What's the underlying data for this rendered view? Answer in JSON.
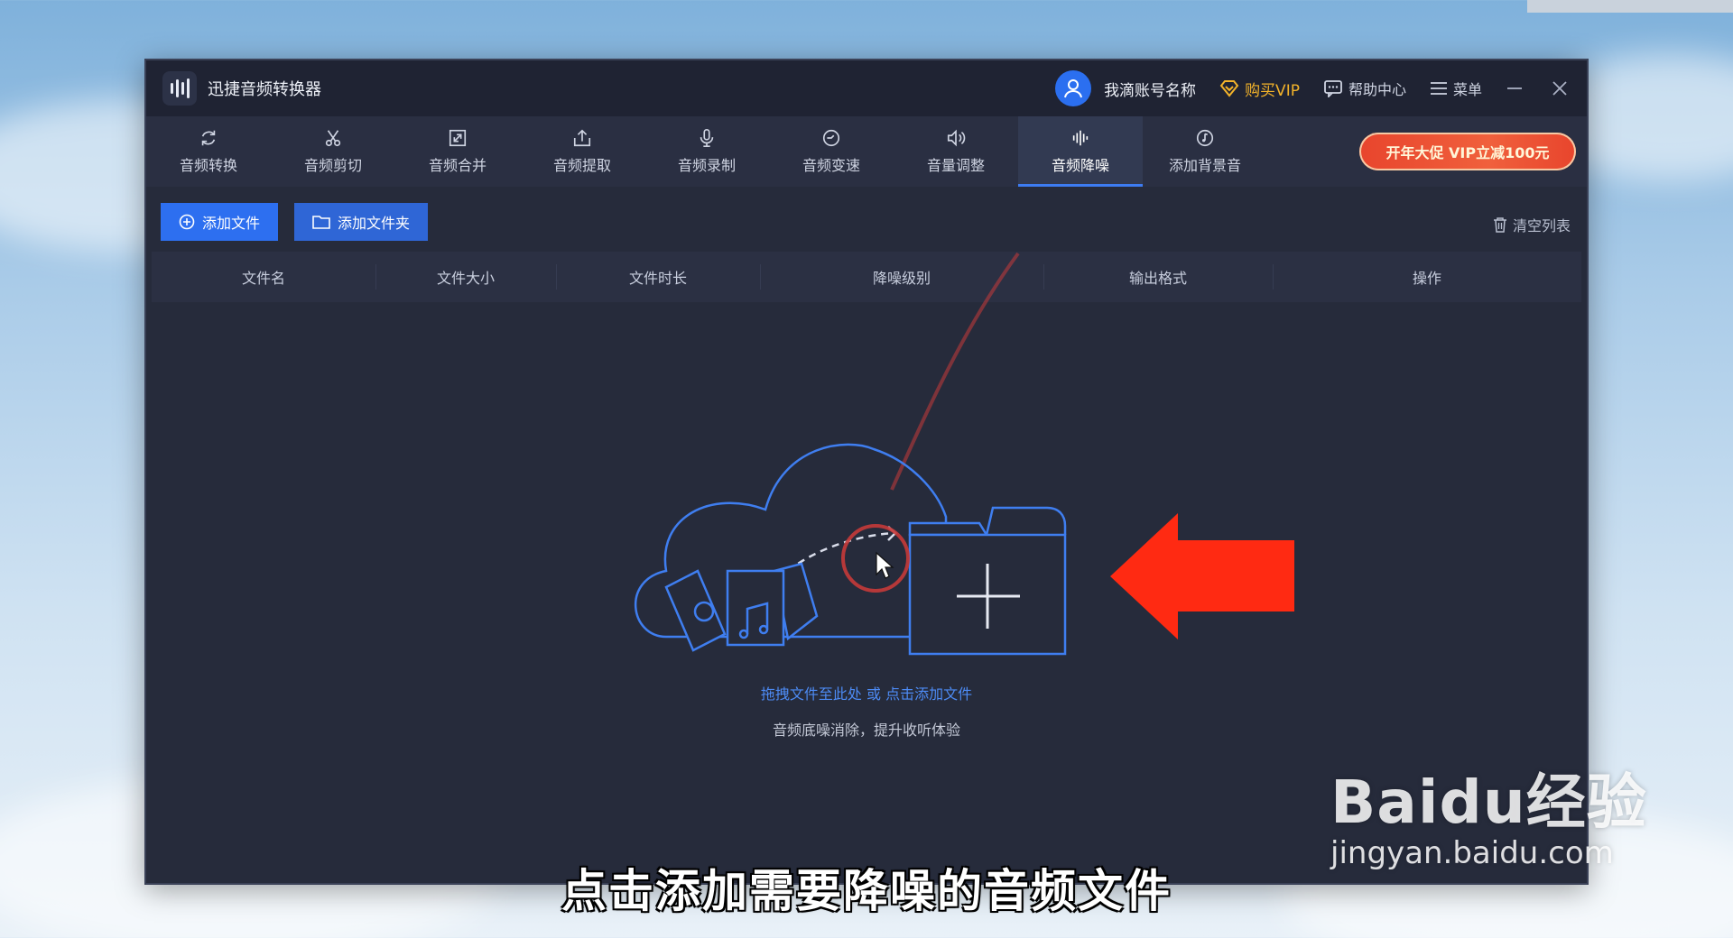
{
  "app": {
    "title": "迅捷音频转换器",
    "account_name": "我滴账号名称",
    "buy_vip": "购买VIP",
    "help_center": "帮助中心",
    "menu": "菜单"
  },
  "toolbar": {
    "tools": [
      {
        "label": "音频转换",
        "icon": "refresh-icon"
      },
      {
        "label": "音频剪切",
        "icon": "scissors-icon"
      },
      {
        "label": "音频合并",
        "icon": "merge-icon"
      },
      {
        "label": "音频提取",
        "icon": "extract-icon"
      },
      {
        "label": "音频录制",
        "icon": "microphone-icon"
      },
      {
        "label": "音频变速",
        "icon": "speed-icon"
      },
      {
        "label": "音量调整",
        "icon": "volume-icon"
      },
      {
        "label": "音频降噪",
        "icon": "waveform-icon",
        "active": true
      },
      {
        "label": "添加背景音",
        "icon": "music-note-icon"
      }
    ],
    "promo": "开年大促 VIP立减100元"
  },
  "actions": {
    "add_file": "添加文件",
    "add_folder": "添加文件夹",
    "clear_list": "清空列表"
  },
  "table": {
    "columns": [
      "文件名",
      "文件大小",
      "文件时长",
      "降噪级别",
      "输出格式",
      "操作"
    ]
  },
  "dropzone": {
    "hint_link": "拖拽文件至此处 或 点击添加文件",
    "description": "音频底噪消除，提升收听体验"
  },
  "overlay": {
    "subtitle": "点击添加需要降噪的音频文件",
    "watermark_main": "Baidu经验",
    "watermark_url": "jingyan.baidu.com"
  },
  "colors": {
    "accent": "#2d6ff0",
    "window_bg": "#262b3b",
    "vip": "#f3b32a",
    "arrow": "#ff2a12"
  }
}
